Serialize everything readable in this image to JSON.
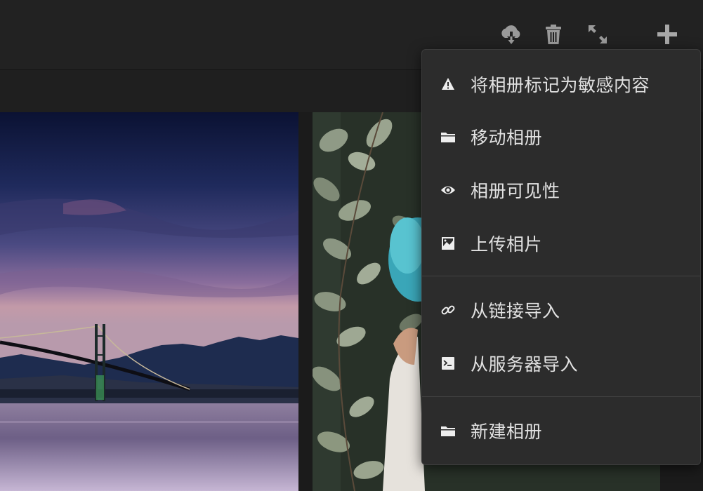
{
  "header": {
    "actions": [
      {
        "icon": "cloud-download-icon",
        "label": "download"
      },
      {
        "icon": "trash-icon",
        "label": "delete"
      },
      {
        "icon": "fullscreen-icon",
        "label": "fullscreen"
      },
      {
        "icon": "plus-icon",
        "label": "add"
      }
    ]
  },
  "photos": [
    {
      "subject": "bridge-sunset-photo"
    },
    {
      "subject": "blue-hair-portrait-photo"
    }
  ],
  "menu": {
    "items": [
      {
        "icon": "warning-icon",
        "label": "将相册标记为敏感内容"
      },
      {
        "icon": "folder-icon",
        "label": "移动相册"
      },
      {
        "icon": "eye-icon",
        "label": "相册可见性"
      },
      {
        "icon": "image-icon",
        "label": "上传相片"
      },
      {
        "icon": "link-icon",
        "label": "从链接导入"
      },
      {
        "icon": "terminal-icon",
        "label": "从服务器导入"
      },
      {
        "icon": "folder-icon",
        "label": "新建相册"
      }
    ]
  },
  "colors": {
    "header_bg": "#222222",
    "page_bg": "#1b1b1b",
    "menu_bg": "#2c2c2c",
    "menu_text": "#e2e2e2",
    "icon_gray": "#9a9a9a"
  }
}
